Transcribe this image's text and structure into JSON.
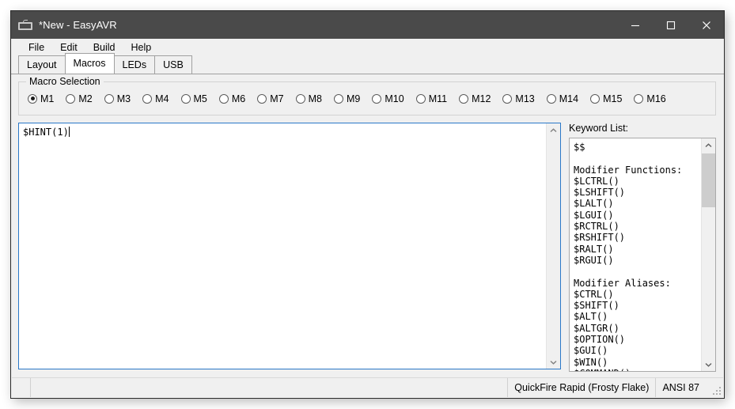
{
  "window": {
    "title": "*New - EasyAVR",
    "icon": "keyboard-icon",
    "controls": {
      "minimize": "minimize-icon",
      "maximize": "maximize-icon",
      "close": "close-icon"
    }
  },
  "menubar": {
    "items": [
      {
        "label": "File"
      },
      {
        "label": "Edit"
      },
      {
        "label": "Build"
      },
      {
        "label": "Help"
      }
    ]
  },
  "tabs": {
    "active": "Macros",
    "items": [
      {
        "label": "Layout"
      },
      {
        "label": "Macros"
      },
      {
        "label": "LEDs"
      },
      {
        "label": "USB"
      }
    ]
  },
  "macro_selection": {
    "legend": "Macro Selection",
    "selected": "M1",
    "options": [
      {
        "label": "M1"
      },
      {
        "label": "M2"
      },
      {
        "label": "M3"
      },
      {
        "label": "M4"
      },
      {
        "label": "M5"
      },
      {
        "label": "M6"
      },
      {
        "label": "M7"
      },
      {
        "label": "M8"
      },
      {
        "label": "M9"
      },
      {
        "label": "M10"
      },
      {
        "label": "M11"
      },
      {
        "label": "M12"
      },
      {
        "label": "M13"
      },
      {
        "label": "M14"
      },
      {
        "label": "M15"
      },
      {
        "label": "M16"
      }
    ]
  },
  "editor": {
    "value": "$HINT(1)",
    "placeholder": ""
  },
  "keyword_panel": {
    "label": "Keyword List:",
    "text": "$$\n\nModifier Functions:\n$LCTRL()\n$LSHIFT()\n$LALT()\n$LGUI()\n$RCTRL()\n$RSHIFT()\n$RALT()\n$RGUI()\n\nModifier Aliases:\n$CTRL()\n$SHIFT()\n$ALT()\n$ALTGR()\n$OPTION()\n$GUI()\n$WIN()\n$COMMAND()"
  },
  "statusbar": {
    "segment1": "",
    "segment2": "",
    "keyboard": "QuickFire Rapid (Frosty Flake)",
    "layout": "ANSI 87"
  },
  "colors": {
    "titlebar": "#4a4a4a",
    "window_bg": "#f0f0f0",
    "focus_border": "#2a78c8",
    "text": "#000000"
  }
}
